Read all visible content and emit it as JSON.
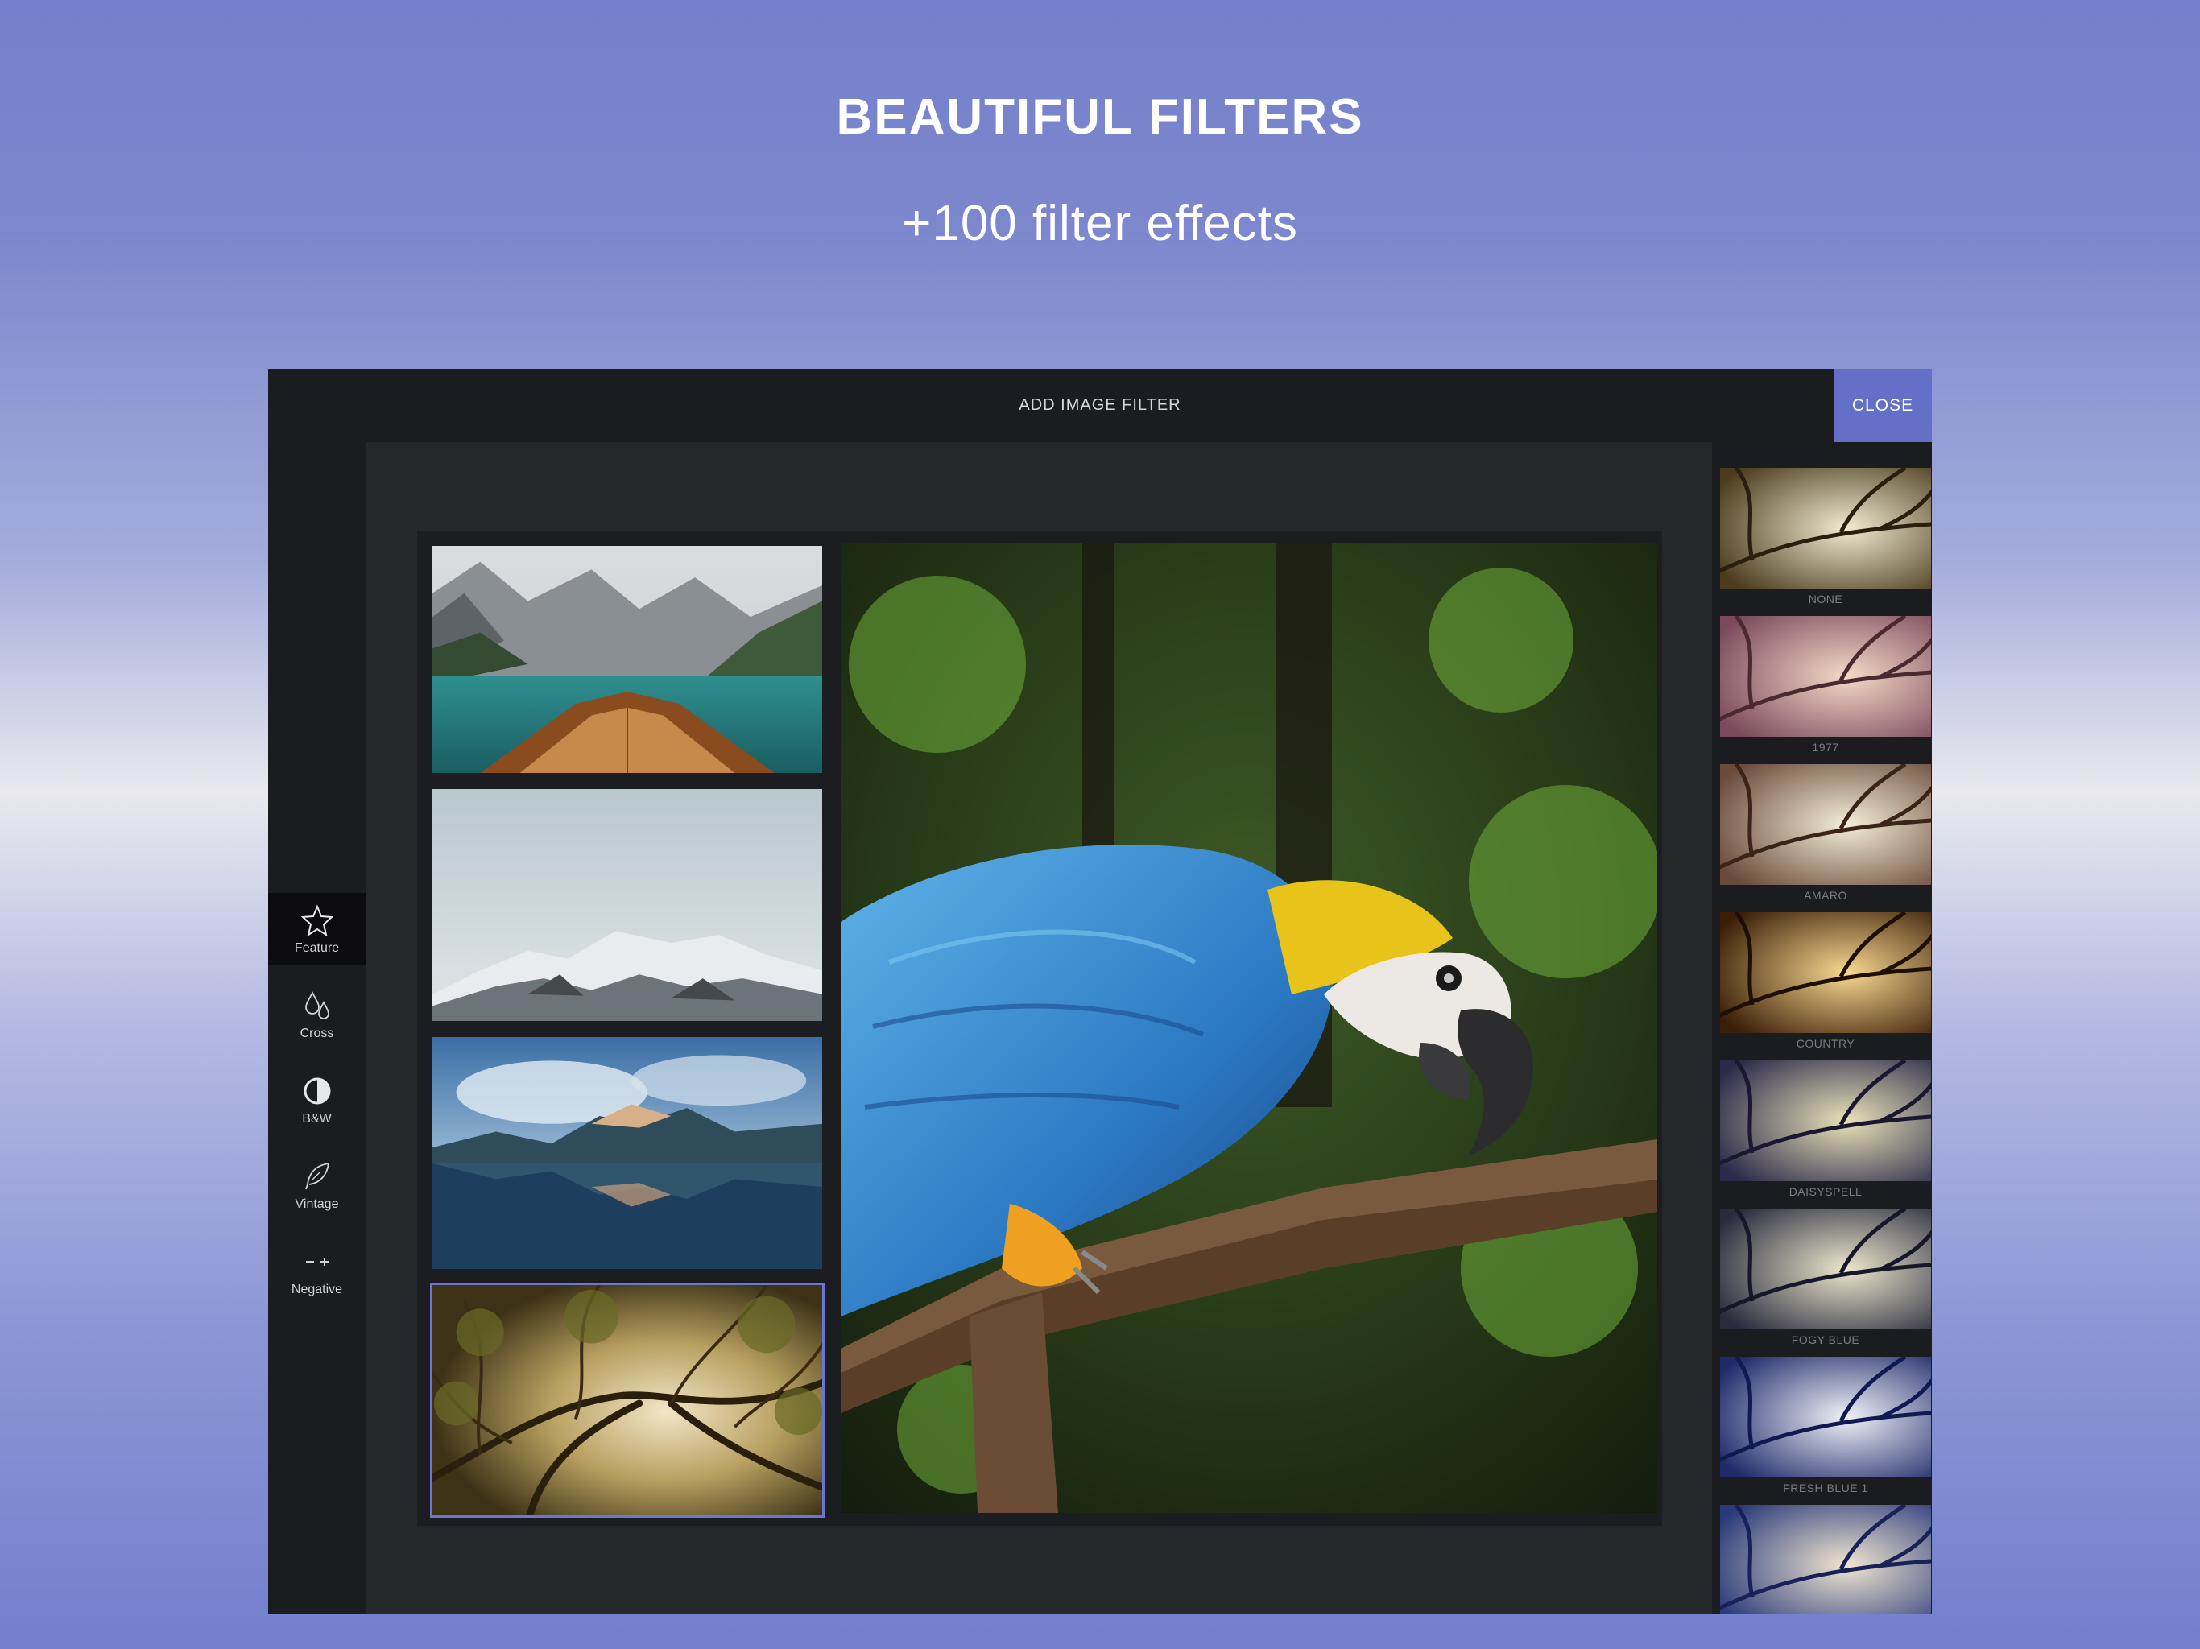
{
  "promo": {
    "title": "BEAUTIFUL FILTERS",
    "subtitle": "+100 filter effects"
  },
  "header": {
    "title": "ADD IMAGE FILTER",
    "close_label": "CLOSE"
  },
  "sidebar": {
    "items": [
      {
        "label": "Feature",
        "icon": "star-icon",
        "active": true
      },
      {
        "label": "Cross",
        "icon": "drops-icon",
        "active": false
      },
      {
        "label": "B&W",
        "icon": "half-circle-icon",
        "active": false
      },
      {
        "label": "Vintage",
        "icon": "feather-icon",
        "active": false
      },
      {
        "label": "Negative",
        "icon": "minus-plus-icon",
        "active": false
      }
    ]
  },
  "photos": {
    "thumbnails": [
      {
        "subject": "mountain lake with boat",
        "selected": false
      },
      {
        "subject": "snowy mountain range",
        "selected": false
      },
      {
        "subject": "mountain lake reflection",
        "selected": false
      },
      {
        "subject": "tree canopy",
        "selected": true
      }
    ],
    "main": {
      "subject": "blue and yellow macaw on branch"
    }
  },
  "filters": {
    "items": [
      {
        "label": "NONE"
      },
      {
        "label": "1977"
      },
      {
        "label": "AMARO"
      },
      {
        "label": "COUNTRY"
      },
      {
        "label": "DAISYSPELL"
      },
      {
        "label": "FOGY BLUE"
      },
      {
        "label": "FRESH BLUE 1"
      },
      {
        "label": ""
      }
    ]
  },
  "colors": {
    "accent": "#6470c8",
    "selection": "#6b75d2",
    "panel": "#1b1c20",
    "canvas": "#25272b"
  }
}
